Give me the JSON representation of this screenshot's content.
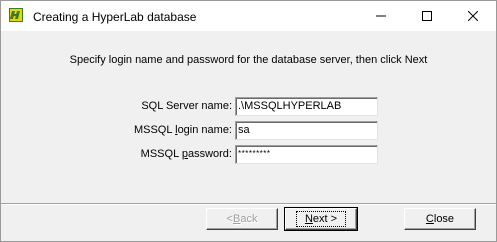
{
  "window": {
    "title": "Creating a HyperLab database",
    "icon": "hyperlab-app-icon"
  },
  "titlebar_buttons": {
    "minimize": "minimize-icon",
    "maximize": "maximize-icon",
    "close": "close-icon"
  },
  "instruction": "Specify login name and password for the database server, then click Next",
  "fields": {
    "server_name": {
      "label": "SQL Server name:",
      "mnemonic_char": "",
      "value": ".\\MSSQLHYPERLAB"
    },
    "login_name": {
      "label_before": "MSSQL ",
      "label_mnemonic": "l",
      "label_after": "ogin name:",
      "value": "sa"
    },
    "password": {
      "label_before": "MSSQL ",
      "label_mnemonic": "p",
      "label_after": "assword:",
      "value": "*********"
    }
  },
  "buttons": {
    "back": {
      "prefix": "< ",
      "mnemonic": "B",
      "rest": "ack",
      "enabled": false
    },
    "next": {
      "mnemonic": "N",
      "rest": "ext >",
      "default": true
    },
    "close": {
      "mnemonic": "C",
      "rest": "lose"
    }
  },
  "colors": {
    "face": "#f0f0f0",
    "window_border": "#9a9a9a",
    "disabled_text": "#a0a0a0",
    "app_icon_yellow": "#e8d800",
    "app_icon_green": "#3a7a2a"
  }
}
